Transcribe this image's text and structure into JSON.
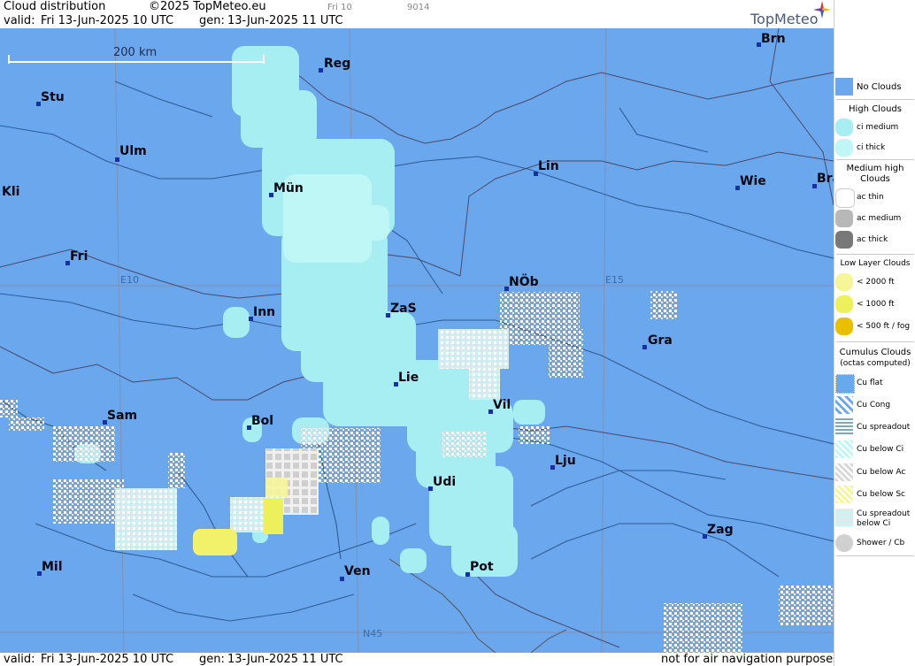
{
  "header": {
    "title": "Cloud distribution",
    "copyright": "©2025 TopMeteo.eu",
    "small_code_1": "Fri 10",
    "small_code_2": "9014",
    "valid_label": "valid:",
    "valid_value": "Fri  13-Jun-2025  10 UTC",
    "gen_label": "gen:",
    "gen_value": "13-Jun-2025 11 UTC",
    "brand": "TopMeteo"
  },
  "footer": {
    "valid_label": "valid:",
    "valid_value": "Fri  13-Jun-2025  10 UTC",
    "gen_label": "gen:",
    "gen_value": "13-Jun-2025 11 UTC",
    "disclaimer": "not for air navigation purposes"
  },
  "map": {
    "scale_label": "200 km",
    "grid_labels": {
      "e10": "E10",
      "e15": "E15",
      "n45": "N45"
    },
    "cities": {
      "brn": "Brn",
      "reg": "Reg",
      "stu": "Stu",
      "ulm": "Ulm",
      "kli": "Kli",
      "mun": "Mün",
      "lin": "Lin",
      "wie": "Wie",
      "bra": "Bra",
      "fri": "Fri",
      "nob": "NÖb",
      "inn": "Inn",
      "zas": "ZaS",
      "gra": "Gra",
      "lie": "Lie",
      "vil": "Vil",
      "sam": "Sam",
      "bol": "Bol",
      "lju": "Lju",
      "udi": "Udi",
      "zag": "Zag",
      "mil": "Mil",
      "ven": "Ven",
      "pot": "Pot"
    }
  },
  "legend": {
    "no_clouds": "No Clouds",
    "high_clouds": "High Clouds",
    "ci_medium": "ci medium",
    "ci_thick": "ci thick",
    "medium_high_clouds_1": "Medium high",
    "medium_high_clouds_2": "Clouds",
    "ac_thin": "ac thin",
    "ac_medium": "ac medium",
    "ac_thick": "ac thick",
    "low_layer_clouds": "Low Layer Clouds",
    "lt_2000": "< 2000 ft",
    "lt_1000": "< 1000 ft",
    "lt_500": "< 500 ft / fog",
    "cumulus_clouds": "Cumulus Clouds",
    "octas_computed": "(octas computed)",
    "cu_flat": "Cu flat",
    "cu_cong": "Cu Cong",
    "cu_spreadout": "Cu spreadout",
    "cu_below_ci": "Cu below Ci",
    "cu_below_ac": "Cu below Ac",
    "cu_below_sc": "Cu below Sc",
    "cu_spreadout_below_ci_1": "Cu spreadout",
    "cu_spreadout_below_ci_2": "below Ci",
    "shower_cb": "Shower / Cb"
  },
  "colors": {
    "background": "#6aa7ec",
    "ci_medium": "#a6eef2",
    "ci_thick": "#bff7f7",
    "low_2000": "#f5f59a",
    "low_1000": "#ecf05a",
    "fog": "#e8c000",
    "ac": "#d8d8d8"
  }
}
